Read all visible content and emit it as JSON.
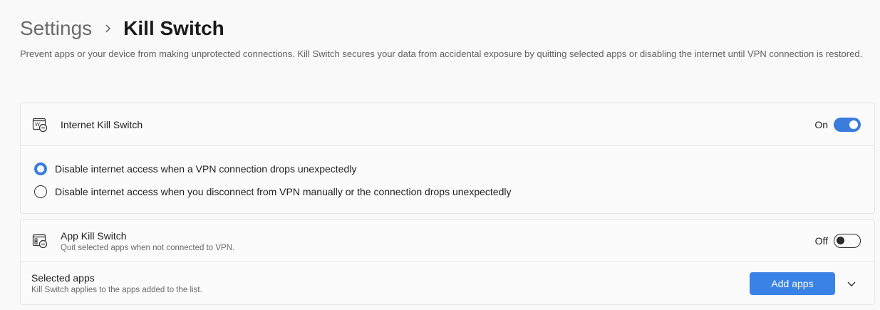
{
  "breadcrumb": {
    "parent": "Settings",
    "current": "Kill Switch"
  },
  "description": "Prevent apps or your device from making unprotected connections. Kill Switch secures your data from accidental exposure by quitting selected apps or disabling the internet until VPN connection is restored.",
  "internet_kill_switch": {
    "icon": "internet-kill-switch-icon",
    "title": "Internet Kill Switch",
    "toggle_label": "On",
    "toggle_state": true,
    "options": [
      {
        "label": "Disable internet access when a VPN connection drops unexpectedly",
        "selected": true
      },
      {
        "label": "Disable internet access when you disconnect from VPN manually or the connection drops unexpectedly",
        "selected": false
      }
    ]
  },
  "app_kill_switch": {
    "icon": "app-kill-switch-icon",
    "title": "App Kill Switch",
    "subtitle": "Quit selected apps when not connected to VPN.",
    "toggle_label": "Off",
    "toggle_state": false
  },
  "selected_apps": {
    "title": "Selected apps",
    "subtitle": "Kill Switch applies to the apps added to the list.",
    "button_label": "Add apps"
  },
  "colors": {
    "accent": "#3b82e6",
    "toggle_on": "#3b7ddd"
  }
}
